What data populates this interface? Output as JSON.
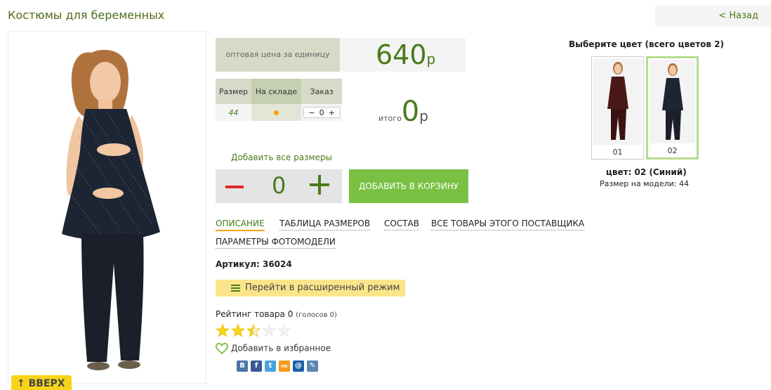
{
  "header": {
    "title": "Костюмы для беременных",
    "back_label": "< Назад"
  },
  "price": {
    "label": "оптовая цена за единицу",
    "value": "640",
    "currency": "р"
  },
  "size_table": {
    "col_size": "Размер",
    "col_stock": "На складе",
    "col_order": "Заказ",
    "rows": [
      {
        "size": "44",
        "qty": "0",
        "minus": "−",
        "plus": "+"
      }
    ]
  },
  "total": {
    "label": "итого",
    "value": "0",
    "currency": "р"
  },
  "add_all_sizes": "Добавить все размеры",
  "quantity": {
    "value": "0"
  },
  "cart_button": "ДОБАВИТЬ В КОРЗИНУ",
  "tabs": [
    {
      "label": "ОПИСАНИЕ",
      "active": true
    },
    {
      "label": "ТАБЛИЦА РАЗМЕРОВ",
      "active": false
    },
    {
      "label": "СОСТАВ",
      "active": false
    },
    {
      "label": "ВСЕ ТОВАРЫ ЭТОГО ПОСТАВЩИКА",
      "active": false
    },
    {
      "label": "ПАРАМЕТРЫ ФОТОМОДЕЛИ",
      "active": false
    }
  ],
  "sku": "Артикул: 36024",
  "extended_mode": "Перейти в расширенный режим",
  "rating": {
    "label": "Рейтинг товара 0",
    "votes": "(голосов 0)",
    "stars": 2.5,
    "max_stars": 5
  },
  "favorites": "Добавить в избранное",
  "share_icons": [
    {
      "icon": "vk-icon",
      "glyph": "В",
      "color": "#4a76a8"
    },
    {
      "icon": "facebook-icon",
      "glyph": "f",
      "color": "#3b5998"
    },
    {
      "icon": "twitter-icon",
      "glyph": "t",
      "color": "#4aa3df"
    },
    {
      "icon": "odnoklassniki-icon",
      "glyph": "ок",
      "color": "#f59a1b"
    },
    {
      "icon": "mail-icon",
      "glyph": "@",
      "color": "#1c5fa8"
    },
    {
      "icon": "livejournal-icon",
      "glyph": "✎",
      "color": "#5d86b5"
    }
  ],
  "colors": {
    "title": "Выберите цвет (всего цветов 2)",
    "swatches": [
      {
        "num": "01",
        "selected": false
      },
      {
        "num": "02",
        "selected": true
      }
    ],
    "selected_name": "цвет: 02 (Синий)",
    "model_size": "Размер на модели: 44"
  },
  "up_button": "↑ ВВЕРХ",
  "palette": {
    "accent_green": "#4a7b1a",
    "button_green": "#79c043",
    "highlight_yellow": "#fbe58b",
    "star_yellow": "#f7d418"
  }
}
